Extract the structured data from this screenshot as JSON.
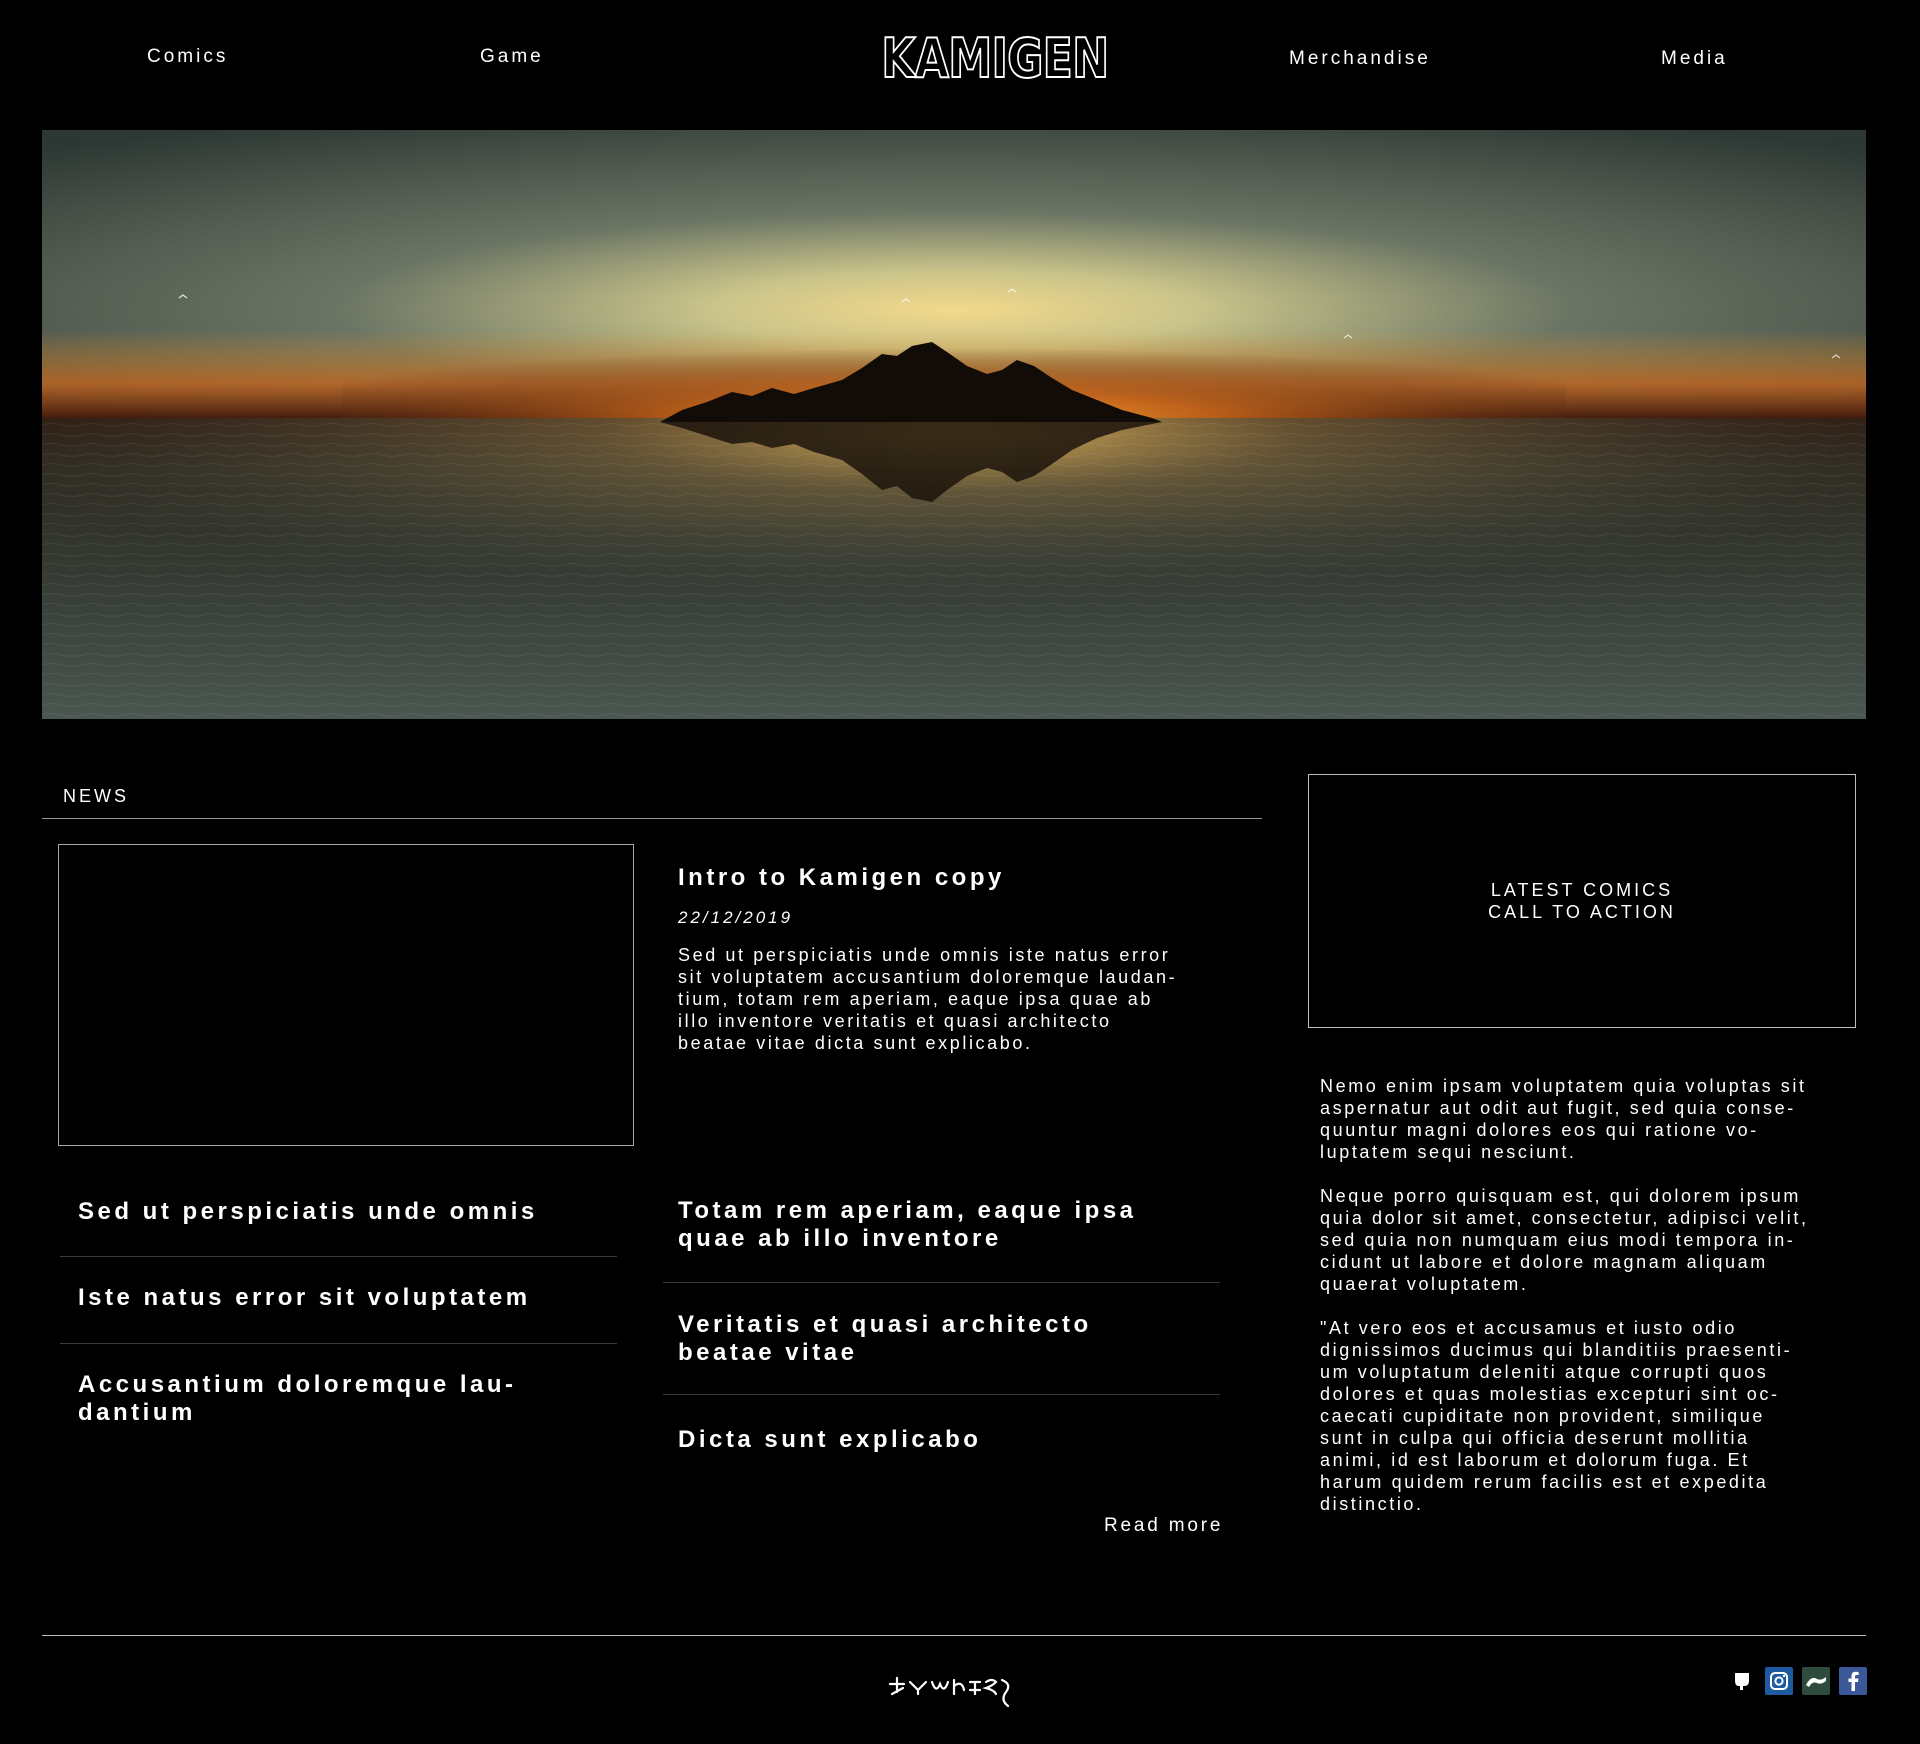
{
  "nav": {
    "left": [
      "Comics",
      "Game"
    ],
    "right": [
      "Merchandise",
      "Media"
    ],
    "logo": "KAMIGEN"
  },
  "news": {
    "section_label": "NEWS",
    "feature": {
      "title": "Intro to Kamigen copy",
      "date": "22/12/2019",
      "body_lines": [
        "Sed ut perspiciatis unde omnis iste natus error",
        "sit voluptatem accusantium doloremque laudan-",
        "tium, totam rem aperiam, eaque ipsa quae ab",
        "illo inventore veritatis et quasi architecto",
        "beatae vitae dicta sunt explicabo."
      ]
    },
    "left_list": [
      [
        "Sed ut perspiciatis unde omnis"
      ],
      [
        "Iste natus error sit voluptatem"
      ],
      [
        "Accusantium doloremque lau-",
        "dantium"
      ]
    ],
    "right_list": [
      [
        "Totam rem aperiam, eaque ipsa",
        "quae ab illo inventore"
      ],
      [
        "Veritatis et quasi architecto",
        "beatae vitae"
      ],
      [
        "Dicta sunt explicabo"
      ]
    ],
    "read_more": "Read more"
  },
  "sidebar": {
    "cta_lines": [
      "LATEST COMICS",
      "CALL TO ACTION"
    ],
    "paragraphs": [
      [
        "Nemo enim ipsam voluptatem quia voluptas sit",
        "aspernatur aut odit aut fugit, sed quia conse-",
        "quuntur magni dolores eos qui ratione vo-",
        "luptatem sequi nesciunt."
      ],
      [
        "Neque porro quisquam est, qui dolorem ipsum",
        "quia dolor sit amet, consectetur, adipisci velit,",
        "sed quia non numquam eius modi tempora in-",
        "cidunt ut labore et dolore magnam aliquam",
        "quaerat voluptatem."
      ],
      [
        "\"At vero eos et accusamus et iusto odio",
        "dignissimos ducimus qui blanditiis praesenti-",
        "um voluptatum deleniti atque corrupti quos",
        "dolores et quas molestias excepturi sint oc-",
        "caecati cupiditate non provident, similique",
        "sunt in culpa qui officia deserunt mollitia",
        "animi, id est laborum et dolorum fuga. Et",
        "harum quidem rerum facilis est et expedita",
        "distinctio."
      ]
    ]
  },
  "footer": {
    "social": [
      {
        "icon": "patreon-icon",
        "bg": "#000000"
      },
      {
        "icon": "instagram-icon",
        "bg": "#1d5aa0"
      },
      {
        "icon": "deviantart-icon",
        "bg": "#2e4b3e"
      },
      {
        "icon": "facebook-icon",
        "bg": "#3b5998"
      }
    ]
  },
  "colors": {
    "background": "#000000",
    "text": "#ffffff",
    "divider": "#9a9a9a"
  }
}
